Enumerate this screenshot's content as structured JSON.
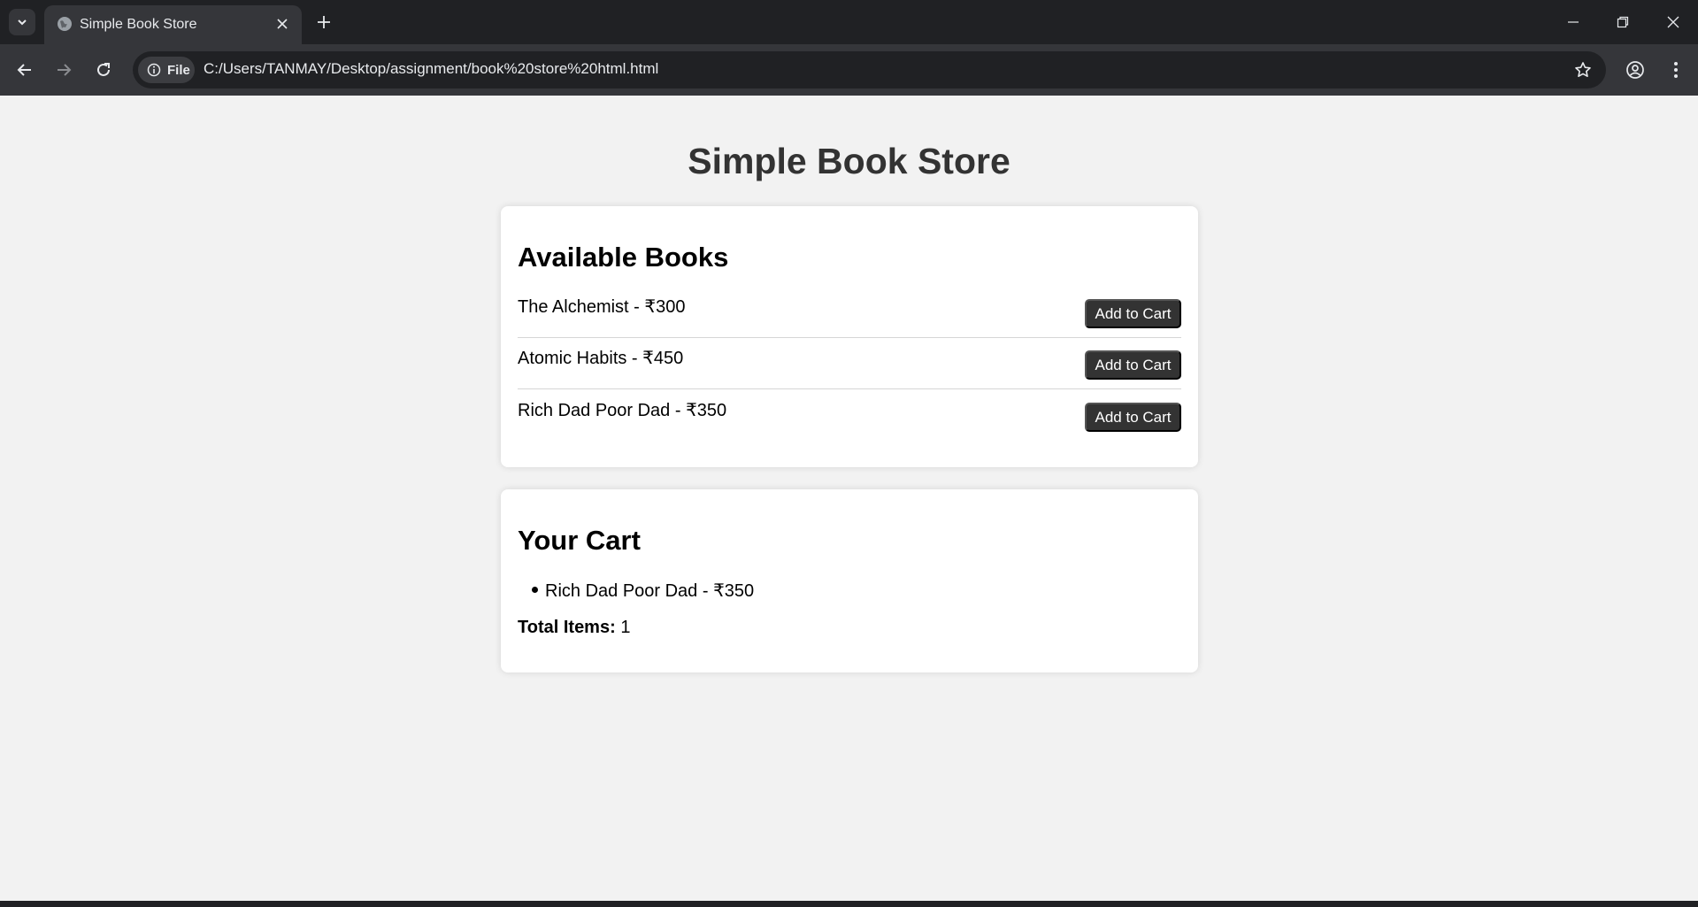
{
  "browser": {
    "tab_title": "Simple Book Store",
    "security_chip_label": "File",
    "url": "C:/Users/TANMAY/Desktop/assignment/book%20store%20html.html"
  },
  "store": {
    "title": "Simple Book Store",
    "books_heading": "Available Books",
    "add_button_label": "Add to Cart",
    "books": [
      {
        "label": "The Alchemist - ₹300"
      },
      {
        "label": "Atomic Habits - ₹450"
      },
      {
        "label": "Rich Dad Poor Dad - ₹350"
      }
    ]
  },
  "cart": {
    "heading": "Your Cart",
    "items": [
      "Rich Dad Poor Dad - ₹350"
    ],
    "total_label": "Total Items:",
    "total_value": "1"
  },
  "colors": {
    "page_background": "#f2f2f2",
    "button_background": "#333333",
    "title_color": "#333333",
    "chrome_dark": "#202124",
    "chrome_toolbar": "#35363a"
  },
  "icons": [
    "tab-search-chevron-icon",
    "globe-icon",
    "close-icon",
    "plus-icon",
    "minimize-icon",
    "restore-icon",
    "back-arrow-icon",
    "forward-arrow-icon",
    "reload-icon",
    "info-icon",
    "star-icon",
    "profile-icon",
    "kebab-menu-icon"
  ]
}
